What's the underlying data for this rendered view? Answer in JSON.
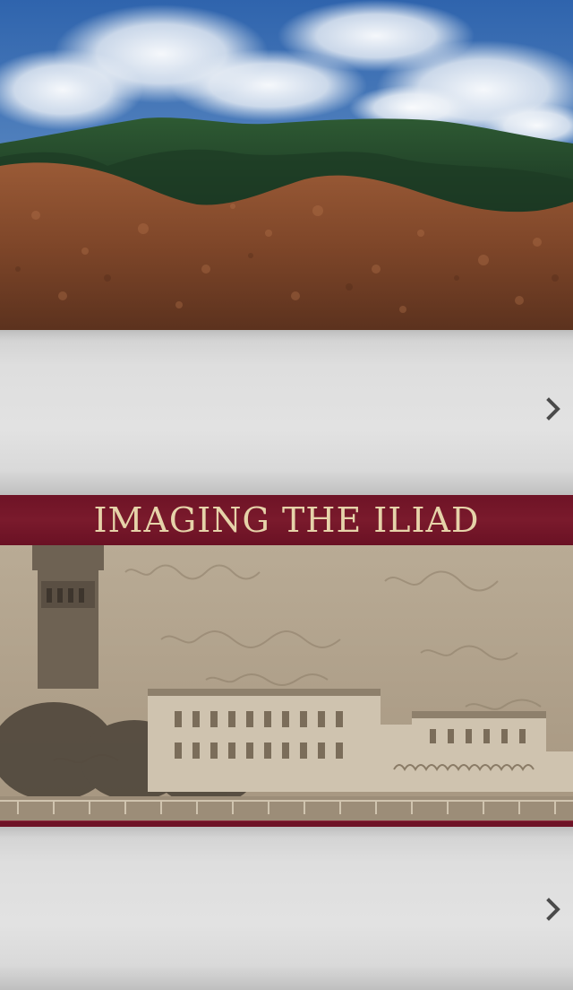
{
  "hero": {
    "icon": "mountain-landscape-image"
  },
  "rows": [
    {
      "chevron_icon": "chevron-right-icon"
    },
    {
      "chevron_icon": "chevron-right-icon"
    }
  ],
  "iliad": {
    "title": "IMAGING THE ILIAD",
    "colors": {
      "band": "#6e1326",
      "title_text": "#e6d3a9",
      "photo_tone": "#b3a48e"
    }
  },
  "colors": {
    "row_background": "#dedede",
    "chevron": "#4a4a4a",
    "soil": "#7a4428",
    "forest": "#1f3d26",
    "sky": "#3f73b8"
  }
}
